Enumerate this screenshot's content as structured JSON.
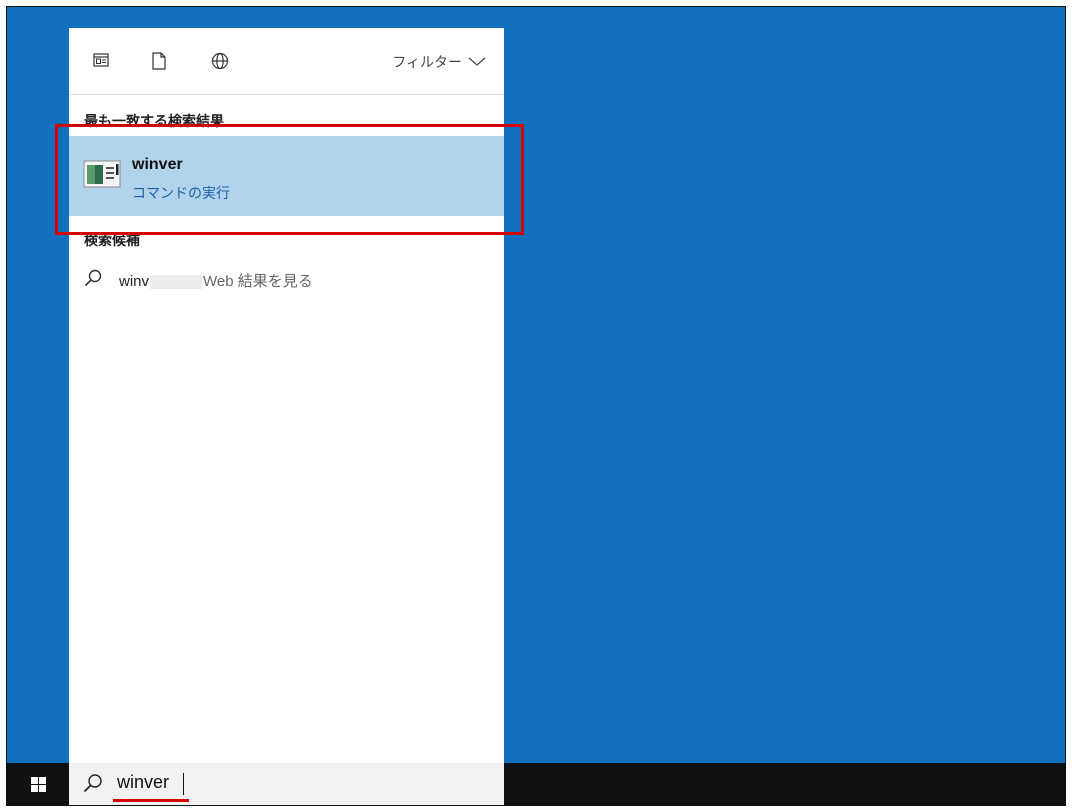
{
  "search_panel": {
    "filter_label": "フィルター",
    "best_match_title": "最も一致する検索結果",
    "best_match": {
      "name": "winver",
      "subtitle": "コマンドの実行"
    },
    "suggestions_title": "検索候補",
    "web_suggestion": {
      "query_prefix": "winv",
      "suffix": "Web 結果を見る"
    }
  },
  "taskbar": {
    "search_value": "winver"
  },
  "colors": {
    "desktop": "#1070bd",
    "highlight": "#b2d3ec",
    "annotation_red": "#d40000"
  }
}
